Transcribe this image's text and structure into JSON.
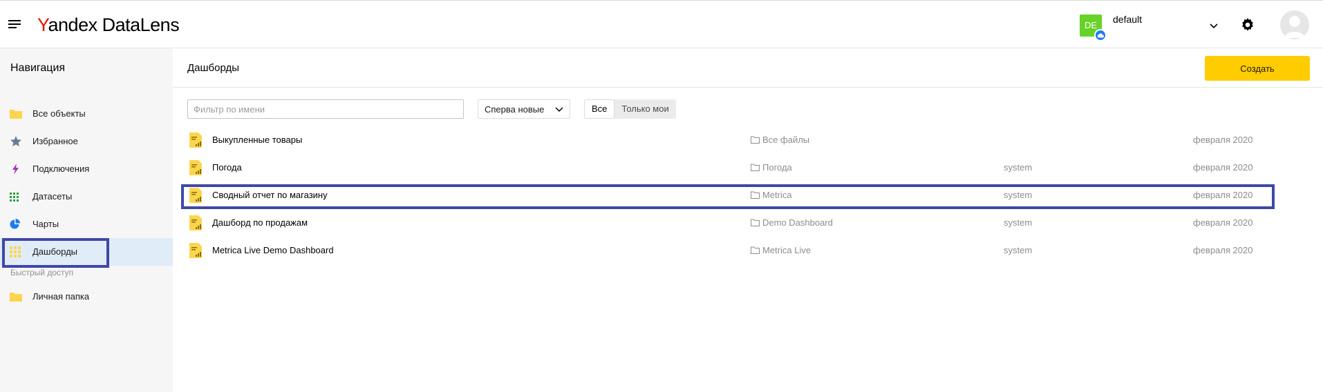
{
  "header": {
    "logo_y": "Y",
    "logo_rest": "andex",
    "logo_product": "DataLens",
    "workspace_badge": "DE",
    "workspace_name": "default"
  },
  "sidebar": {
    "title": "Навигация",
    "items": [
      {
        "label": "Все объекты",
        "icon": "folder-icon",
        "color": "#fcd54e"
      },
      {
        "label": "Избранное",
        "icon": "star-icon",
        "color": "#6b7a99"
      },
      {
        "label": "Подключения",
        "icon": "lightning-icon",
        "color": "#a035b8"
      },
      {
        "label": "Датасеты",
        "icon": "dataset-grid-icon",
        "color": "#2a9d3c"
      },
      {
        "label": "Чарты",
        "icon": "pie-chart-icon",
        "color": "#1f7ded"
      },
      {
        "label": "Дашборды",
        "icon": "dashboard-grid-icon",
        "color": "#fcd54e"
      }
    ],
    "active_index": 5,
    "quick_access_title": "Быстрый доступ",
    "quick_access": [
      {
        "label": "Личная папка",
        "icon": "folder-icon"
      }
    ]
  },
  "main": {
    "title": "Дашборды",
    "create_label": "Создать",
    "filter": {
      "placeholder": "Фильтр по имени",
      "value": ""
    },
    "sort": {
      "selected": "Сперва новые"
    },
    "scope": {
      "options": [
        "Все",
        "Только мои"
      ],
      "selected": "Все"
    },
    "rows": [
      {
        "name": "Выкупленные товары",
        "path": "Все файлы",
        "author": "",
        "date": "февраля 2020"
      },
      {
        "name": "Погода",
        "path": "Погода",
        "author": "system",
        "date": "февраля 2020"
      },
      {
        "name": "Сводный отчет по магазину",
        "path": "Metrica",
        "author": "system",
        "date": "февраля 2020"
      },
      {
        "name": "Дашборд по продажам",
        "path": "Demo Dashboard",
        "author": "system",
        "date": "февраля 2020"
      },
      {
        "name": "Metrica Live Demo Dashboard",
        "path": "Metrica Live",
        "author": "system",
        "date": "февраля 2020"
      }
    ],
    "highlighted_row_index": 2
  },
  "colors": {
    "accent_yellow": "#ffcc00",
    "highlight_border": "#3f47a8",
    "active_bg": "#e0ecf7",
    "workspace_green": "#67d329"
  }
}
